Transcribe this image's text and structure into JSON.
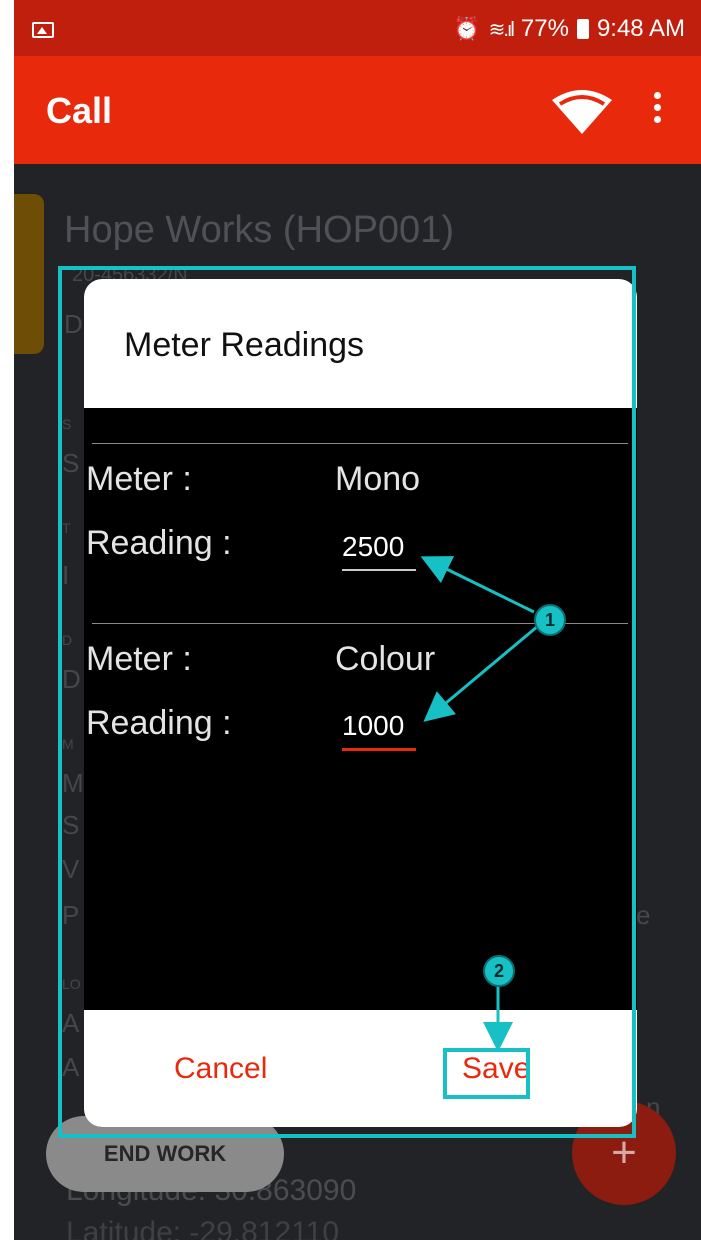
{
  "status_bar": {
    "battery": "77%",
    "time": "9:48 AM"
  },
  "app_bar": {
    "title": "Call"
  },
  "background": {
    "site_title": "Hope Works (HOP001)",
    "site_subtitle": "20-456332/N",
    "end_work_label": "END WORK",
    "fab_label": "+",
    "longitude": "Longitude:  30.863090",
    "latitude": "Latitude:  -29.812110",
    "fragments": [
      "D",
      "S",
      "S",
      "T",
      "I",
      "D",
      "D",
      "M",
      "M",
      "S",
      "V",
      "P",
      "e",
      "LO",
      "A",
      "A",
      "n"
    ]
  },
  "dialog": {
    "title": "Meter Readings",
    "meters": [
      {
        "meter_label": "Meter :",
        "meter_value": "Mono",
        "reading_label": "Reading :",
        "reading_value": "2500"
      },
      {
        "meter_label": "Meter :",
        "meter_value": "Colour",
        "reading_label": "Reading :",
        "reading_value": "1000"
      }
    ],
    "cancel_label": "Cancel",
    "save_label": "Save"
  },
  "annotations": {
    "callout_1": "1",
    "callout_2": "2",
    "color": "#17c0c4"
  },
  "colors": {
    "status_bar": "#c11f0d",
    "app_bar": "#e8290c",
    "accent": "#e8290c"
  }
}
